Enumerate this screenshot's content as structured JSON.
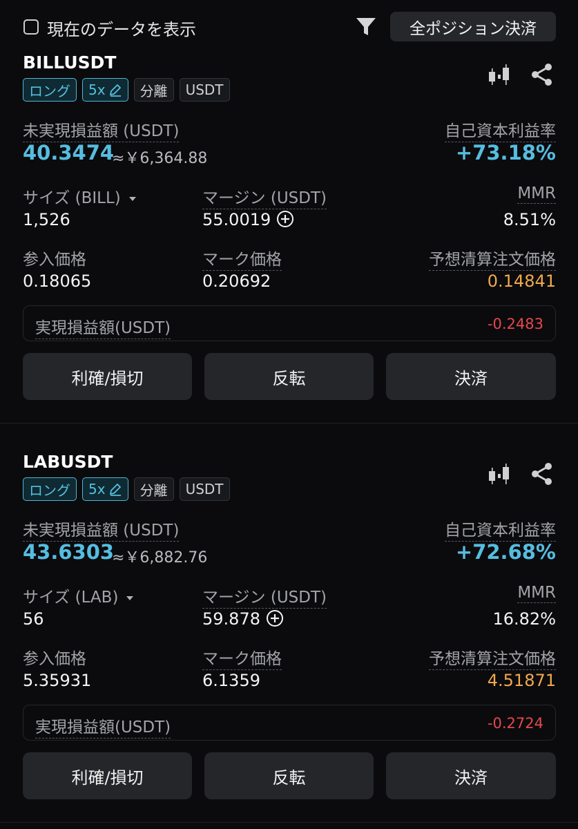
{
  "header": {
    "show_current_data_label": "現在のデータを表示",
    "close_all_label": "全ポジション決済"
  },
  "labels": {
    "unrealized_pnl": "未実現損益額 (USDT)",
    "roe": "自己資本利益率",
    "margin": "マージン (USDT)",
    "mmr": "MMR",
    "entry_price": "参入価格",
    "mark_price": "マーク価格",
    "liq_price": "予想清算注文価格",
    "realized_pnl": "実現損益額(USDT)",
    "tpsl_button": "利確/損切",
    "reverse_button": "反転",
    "close_button": "決済"
  },
  "positions": [
    {
      "symbol": "BILLUSDT",
      "side": "ロング",
      "leverage": "5x",
      "margin_mode": "分離",
      "settle": "USDT",
      "unrealized_pnl": "40.3474",
      "unrealized_pnl_jpy": "≈￥6,364.88",
      "roe": "+73.18%",
      "size_label": "サイズ (BILL)",
      "size": "1,526",
      "margin": "55.0019",
      "mmr": "8.51%",
      "entry_price": "0.18065",
      "mark_price": "0.20692",
      "liq_price": "0.14841",
      "realized_pnl": "-0.2483"
    },
    {
      "symbol": "LABUSDT",
      "side": "ロング",
      "leverage": "5x",
      "margin_mode": "分離",
      "settle": "USDT",
      "unrealized_pnl": "43.6303",
      "unrealized_pnl_jpy": "≈￥6,882.76",
      "roe": "+72.68%",
      "size_label": "サイズ (LAB)",
      "size": "56",
      "margin": "59.878",
      "mmr": "16.82%",
      "entry_price": "5.35931",
      "mark_price": "6.1359",
      "liq_price": "4.51871",
      "realized_pnl": "-0.2724"
    }
  ],
  "colors": {
    "accent_blue": "#55bde0",
    "liq_orange": "#f1a94e",
    "loss_red": "#e5484d"
  }
}
